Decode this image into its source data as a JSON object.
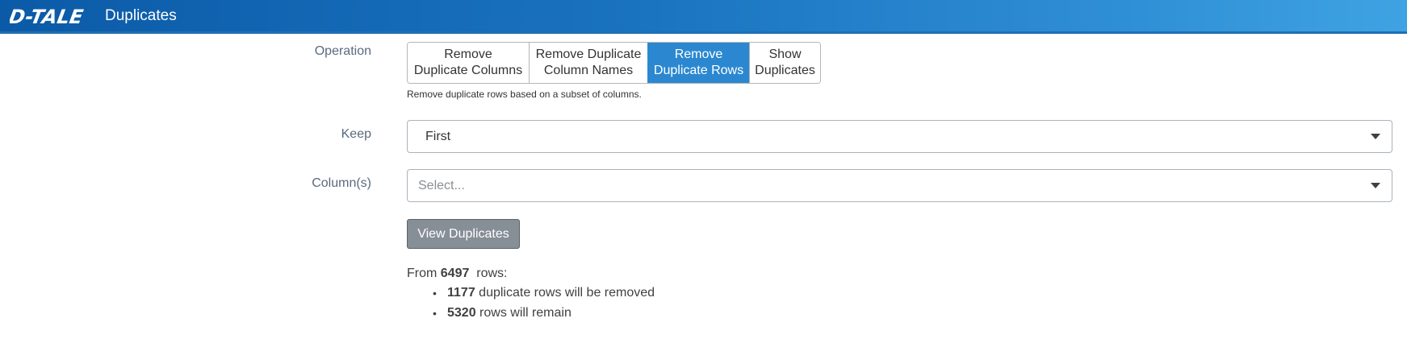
{
  "header": {
    "logo_text": "D-TALE",
    "title": "Duplicates",
    "logo_icon": "dtale-logo"
  },
  "form": {
    "operation_label": "Operation",
    "operations": [
      {
        "label": "Remove\nDuplicate Columns",
        "active": false
      },
      {
        "label": "Remove Duplicate\nColumn Names",
        "active": false
      },
      {
        "label": "Remove\nDuplicate Rows",
        "active": true
      },
      {
        "label": "Show\nDuplicates",
        "active": false
      }
    ],
    "operation_help": "Remove duplicate rows based on a subset of columns.",
    "keep_label": "Keep",
    "keep_value": "First",
    "columns_label": "Column(s)",
    "columns_placeholder": "Select...",
    "view_button": "View Duplicates"
  },
  "summary": {
    "from_prefix": "From",
    "total_rows": "6497",
    "rows_suffix": "rows:",
    "removed_count": "1177",
    "removed_text": "duplicate rows will be removed",
    "remain_count": "5320",
    "remain_text": "rows will remain"
  },
  "colors": {
    "header_start": "#0b5aa7",
    "header_end": "#3fa3e2",
    "active_button": "#2b88d0",
    "view_button": "#868e96"
  }
}
